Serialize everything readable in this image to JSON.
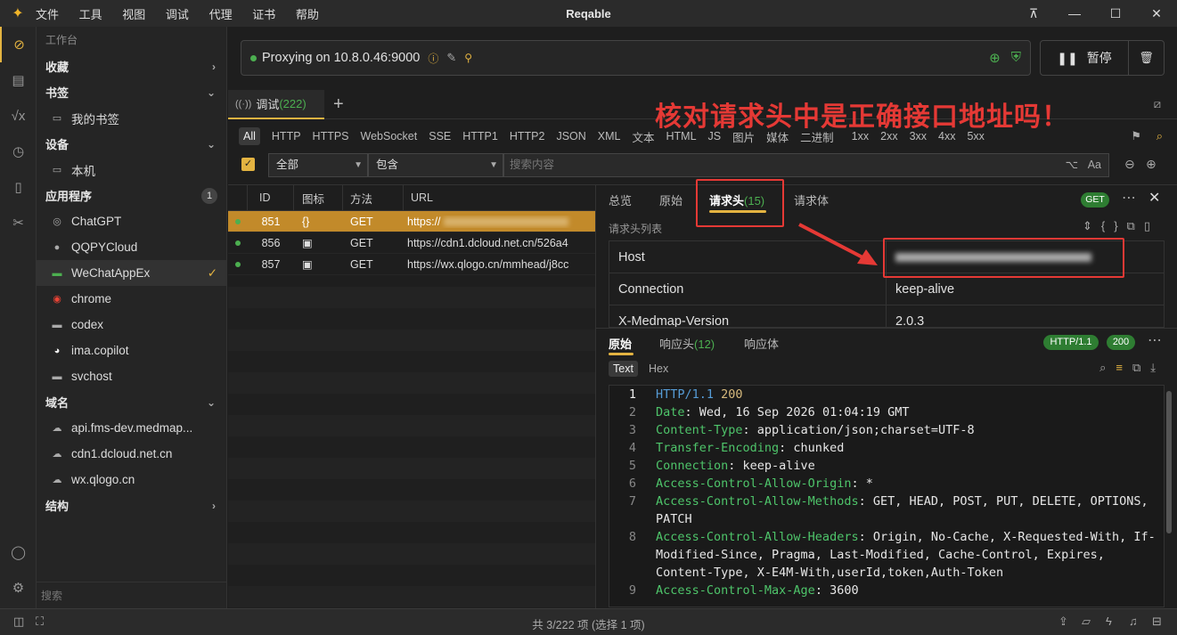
{
  "app": {
    "title": "Reqable"
  },
  "menu": [
    "文件",
    "工具",
    "视图",
    "调试",
    "代理",
    "证书",
    "帮助"
  ],
  "sidebar": {
    "workspace": "工作台",
    "favorites": "收藏",
    "bookmarks": "书签",
    "my_bookmarks": "我的书签",
    "devices": "设备",
    "local": "本机",
    "apps_title": "应用程序",
    "apps_count": "1",
    "apps": [
      "ChatGPT",
      "QQPYCloud",
      "WeChatAppEx",
      "chrome",
      "codex",
      "ima.copilot",
      "svchost"
    ],
    "domains_title": "域名",
    "domains": [
      "api.fms-dev.medmap...",
      "cdn1.dcloud.net.cn",
      "wx.qlogo.cn"
    ],
    "structure": "结构",
    "search_placeholder": "搜索"
  },
  "proxy": {
    "text": "Proxying on 10.8.0.46:9000",
    "pause_label": "暂停"
  },
  "tab": {
    "label": "调试",
    "count": "(222)"
  },
  "annotation": "核对请求头中是正确接口地址吗！",
  "filters": [
    "All",
    "HTTP",
    "HTTPS",
    "WebSocket",
    "SSE",
    "HTTP1",
    "HTTP2",
    "JSON",
    "XML",
    "文本",
    "HTML",
    "JS",
    "图片",
    "媒体",
    "二进制",
    "1xx",
    "2xx",
    "3xx",
    "4xx",
    "5xx"
  ],
  "search": {
    "scope": "全部",
    "mode": "包含",
    "placeholder": "搜索内容",
    "case_label": "Aa"
  },
  "list": {
    "headers": [
      "ID",
      "图标",
      "方法",
      "URL"
    ],
    "rows": [
      {
        "id": "851",
        "icon": "{}",
        "method": "GET",
        "url": "https://"
      },
      {
        "id": "856",
        "icon": "▣",
        "method": "GET",
        "url": "https://cdn1.dcloud.net.cn/526a4"
      },
      {
        "id": "857",
        "icon": "▣",
        "method": "GET",
        "url": "https://wx.qlogo.cn/mmhead/j8cc"
      }
    ]
  },
  "detail": {
    "tabs": [
      "总览",
      "原始",
      "请求头",
      "请求体"
    ],
    "headers_count": "(15)",
    "method_badge": "GET",
    "list_label": "请求头列表",
    "headers": [
      {
        "key": "Host",
        "value": ""
      },
      {
        "key": "Connection",
        "value": "keep-alive"
      },
      {
        "key": "X-Medmap-Version",
        "value": "2.0.3"
      }
    ]
  },
  "response": {
    "tabs": [
      "原始",
      "响应头",
      "响应体"
    ],
    "headers_count": "(12)",
    "protocol_badge": "HTTP/1.1",
    "status_badge": "200",
    "formats": [
      "Text",
      "Hex"
    ],
    "lines": [
      {
        "n": "1",
        "key": "HTTP/1.1",
        "val": " 200",
        "first": true
      },
      {
        "n": "2",
        "key": "Date",
        "val": ": Wed, 16 Sep 2026 01:04:19 GMT"
      },
      {
        "n": "3",
        "key": "Content-Type",
        "val": ": application/json;charset=UTF-8"
      },
      {
        "n": "4",
        "key": "Transfer-Encoding",
        "val": ": chunked"
      },
      {
        "n": "5",
        "key": "Connection",
        "val": ": keep-alive"
      },
      {
        "n": "6",
        "key": "Access-Control-Allow-Origin",
        "val": ": *"
      },
      {
        "n": "7",
        "key": "Access-Control-Allow-Methods",
        "val": ": GET, HEAD, POST, PUT, DELETE, OPTIONS, PATCH"
      },
      {
        "n": "8",
        "key": "Access-Control-Allow-Headers",
        "val": ": Origin, No-Cache, X-Requested-With, If-Modified-Since, Pragma, Last-Modified, Cache-Control, Expires, Content-Type, X-E4M-With,userId,token,Auth-Token"
      },
      {
        "n": "9",
        "key": "Access-Control-Max-Age",
        "val": ": 3600"
      }
    ]
  },
  "status": {
    "text": "共 3/222 项 (选择 1 项)"
  },
  "colors": {
    "accent": "#e3b341",
    "green": "#4caf50",
    "annotation": "#e53935"
  }
}
